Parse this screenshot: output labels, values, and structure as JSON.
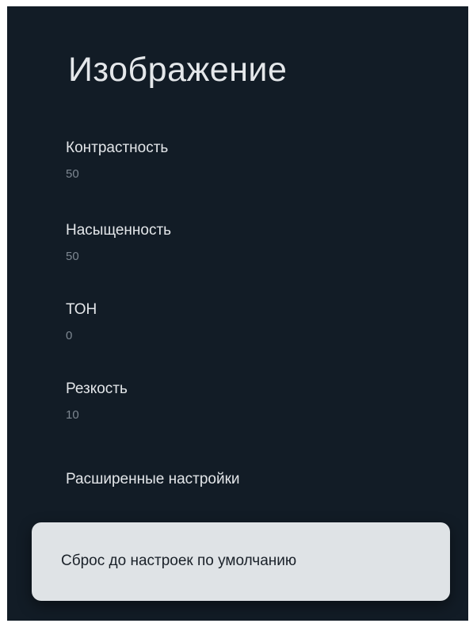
{
  "page": {
    "title": "Изображение"
  },
  "settings": {
    "contrast": {
      "label": "Контрастность",
      "value": "50"
    },
    "saturation": {
      "label": "Насыщенность",
      "value": "50"
    },
    "hue": {
      "label": "ТОН",
      "value": "0"
    },
    "sharpness": {
      "label": "Резкость",
      "value": "10"
    },
    "advanced": {
      "label": "Расширенные настройки"
    },
    "reset": {
      "label": "Сброс до настроек по умолчанию"
    }
  }
}
